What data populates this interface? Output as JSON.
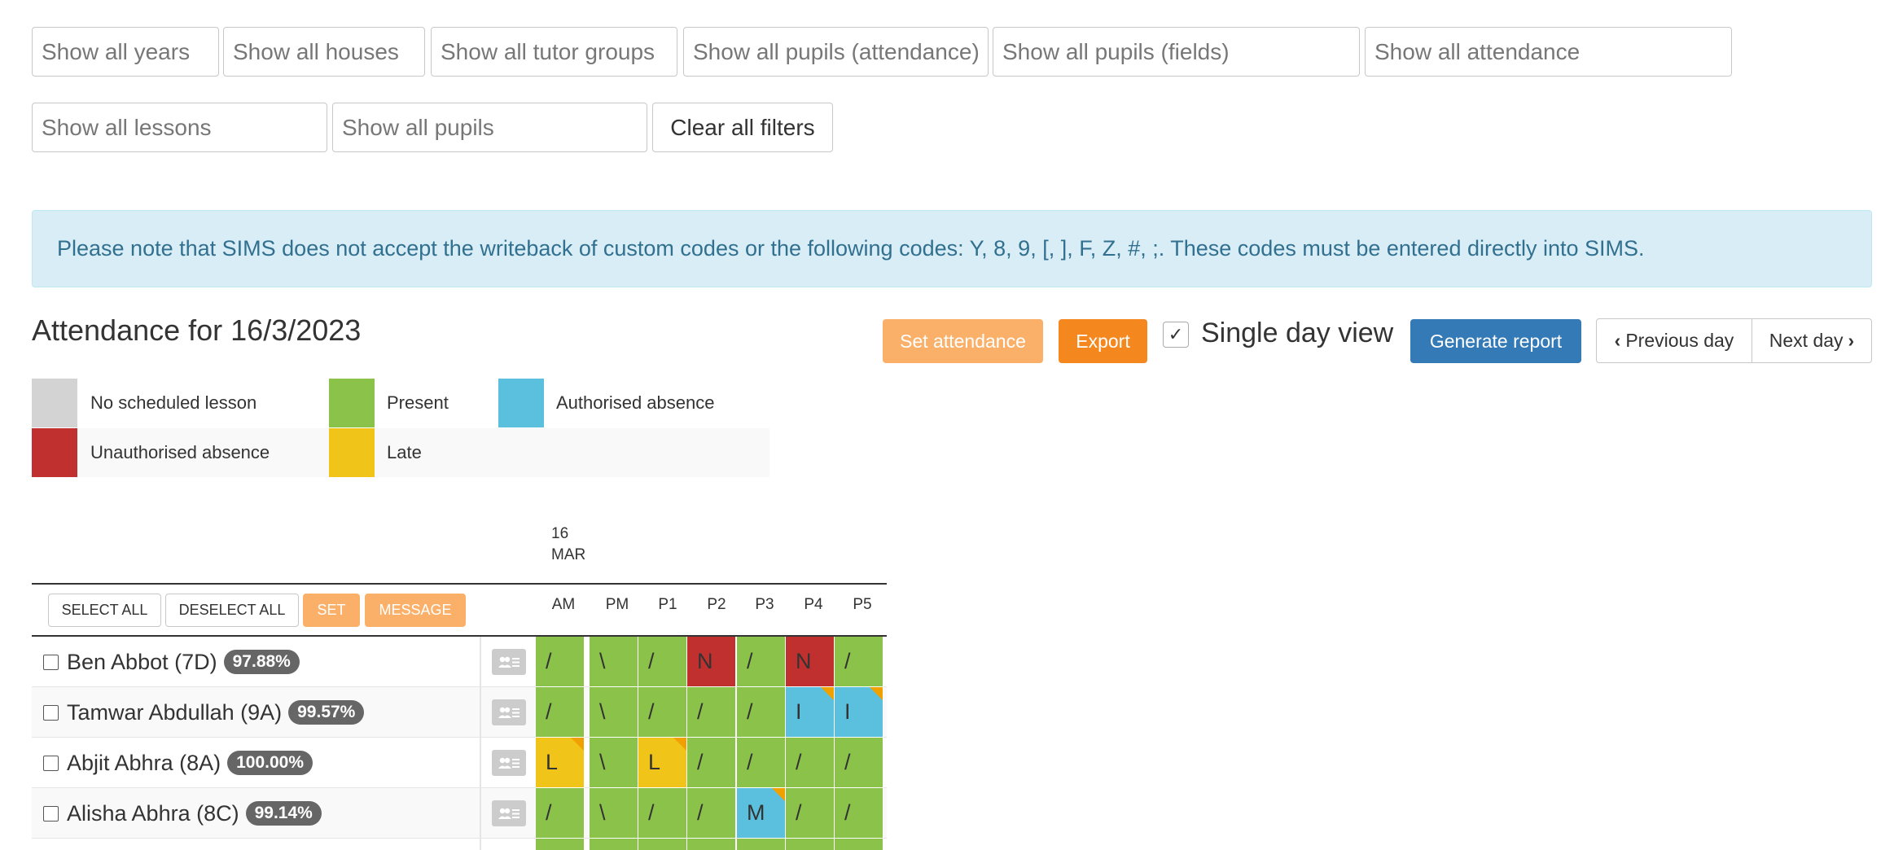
{
  "filters": {
    "years": "Show all years",
    "houses": "Show all houses",
    "tutor_groups": "Show all tutor groups",
    "pupils_attendance": "Show all pupils (attendance)",
    "pupils_fields": "Show all pupils (fields)",
    "attendance": "Show all attendance",
    "lessons": "Show all lessons",
    "pupils": "Show all pupils",
    "clear": "Clear all filters"
  },
  "notice": "Please note that SIMS does not accept the writeback of custom codes or the following codes: Y, 8, 9, [, ], F, Z, #, ;. These codes must be entered directly into SIMS.",
  "title": "Attendance for 16/3/2023",
  "toolbar": {
    "set_attendance": "Set attendance",
    "export": "Export",
    "single_day_view": "Single day view",
    "single_day_checked": true,
    "generate_report": "Generate report",
    "previous_day": "Previous day",
    "next_day": "Next day"
  },
  "legend": {
    "no_lesson": "No scheduled lesson",
    "present": "Present",
    "authorised": "Authorised absence",
    "unauthorised": "Unauthorised absence",
    "late": "Late"
  },
  "colors": {
    "present": "#8bc34a",
    "authorised": "#5bc0de",
    "unauthorised": "#c0302e",
    "late": "#f0c419",
    "no_lesson": "#d3d3d3",
    "primary": "#337ab7",
    "orange": "#f5871f",
    "orange_light": "#fbb069"
  },
  "grid": {
    "date_day": "16",
    "date_month": "MAR",
    "select_all": "SELECT ALL",
    "deselect_all": "DESELECT ALL",
    "set": "SET",
    "message": "MESSAGE",
    "periods": [
      "AM",
      "PM",
      "P1",
      "P2",
      "P3",
      "P4",
      "P5"
    ],
    "pupils": [
      {
        "name": "Ben Abbot (7D)",
        "pct": "97.88%",
        "cells": [
          {
            "code": "/",
            "status": "present"
          },
          {
            "code": "\\",
            "status": "present"
          },
          {
            "code": "/",
            "status": "present"
          },
          {
            "code": "N",
            "status": "unauthorised"
          },
          {
            "code": "/",
            "status": "present"
          },
          {
            "code": "N",
            "status": "unauthorised"
          },
          {
            "code": "/",
            "status": "present"
          }
        ]
      },
      {
        "name": "Tamwar Abdullah (9A)",
        "pct": "99.57%",
        "cells": [
          {
            "code": "/",
            "status": "present"
          },
          {
            "code": "\\",
            "status": "present"
          },
          {
            "code": "/",
            "status": "present"
          },
          {
            "code": "/",
            "status": "present"
          },
          {
            "code": "/",
            "status": "present"
          },
          {
            "code": "I",
            "status": "authorised",
            "marker": true
          },
          {
            "code": "I",
            "status": "authorised",
            "marker": true
          }
        ]
      },
      {
        "name": "Abjit Abhra (8A)",
        "pct": "100.00%",
        "cells": [
          {
            "code": "L",
            "status": "late",
            "marker": true
          },
          {
            "code": "\\",
            "status": "present"
          },
          {
            "code": "L",
            "status": "late",
            "marker": true
          },
          {
            "code": "/",
            "status": "present"
          },
          {
            "code": "/",
            "status": "present"
          },
          {
            "code": "/",
            "status": "present"
          },
          {
            "code": "/",
            "status": "present"
          }
        ]
      },
      {
        "name": "Alisha Abhra (8C)",
        "pct": "99.14%",
        "cells": [
          {
            "code": "/",
            "status": "present"
          },
          {
            "code": "\\",
            "status": "present"
          },
          {
            "code": "/",
            "status": "present"
          },
          {
            "code": "/",
            "status": "present"
          },
          {
            "code": "M",
            "status": "authorised",
            "marker": true
          },
          {
            "code": "/",
            "status": "present"
          },
          {
            "code": "/",
            "status": "present"
          }
        ]
      }
    ]
  }
}
